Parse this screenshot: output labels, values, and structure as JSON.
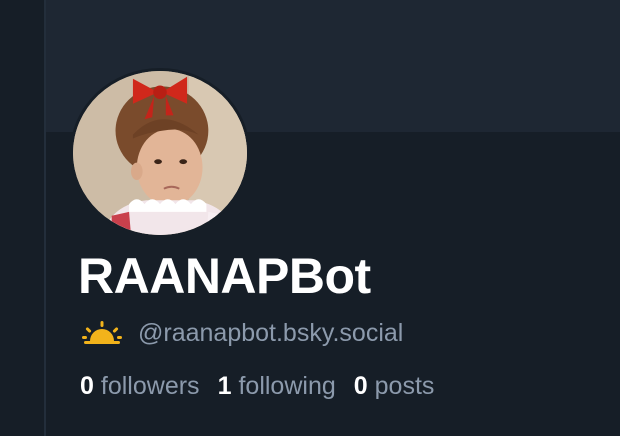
{
  "profile": {
    "display_name": "RAANAPBot",
    "handle": "@raanapbot.bsky.social",
    "badge_icon": "sunrise-icon",
    "stats": [
      {
        "count": "0",
        "label": "followers"
      },
      {
        "count": "1",
        "label": "following"
      },
      {
        "count": "0",
        "label": "posts"
      }
    ]
  },
  "colors": {
    "background": "#161e27",
    "banner": "#1e2733",
    "text_primary": "#ffffff",
    "text_secondary": "#8c9aac",
    "badge": "#f2b31b"
  }
}
